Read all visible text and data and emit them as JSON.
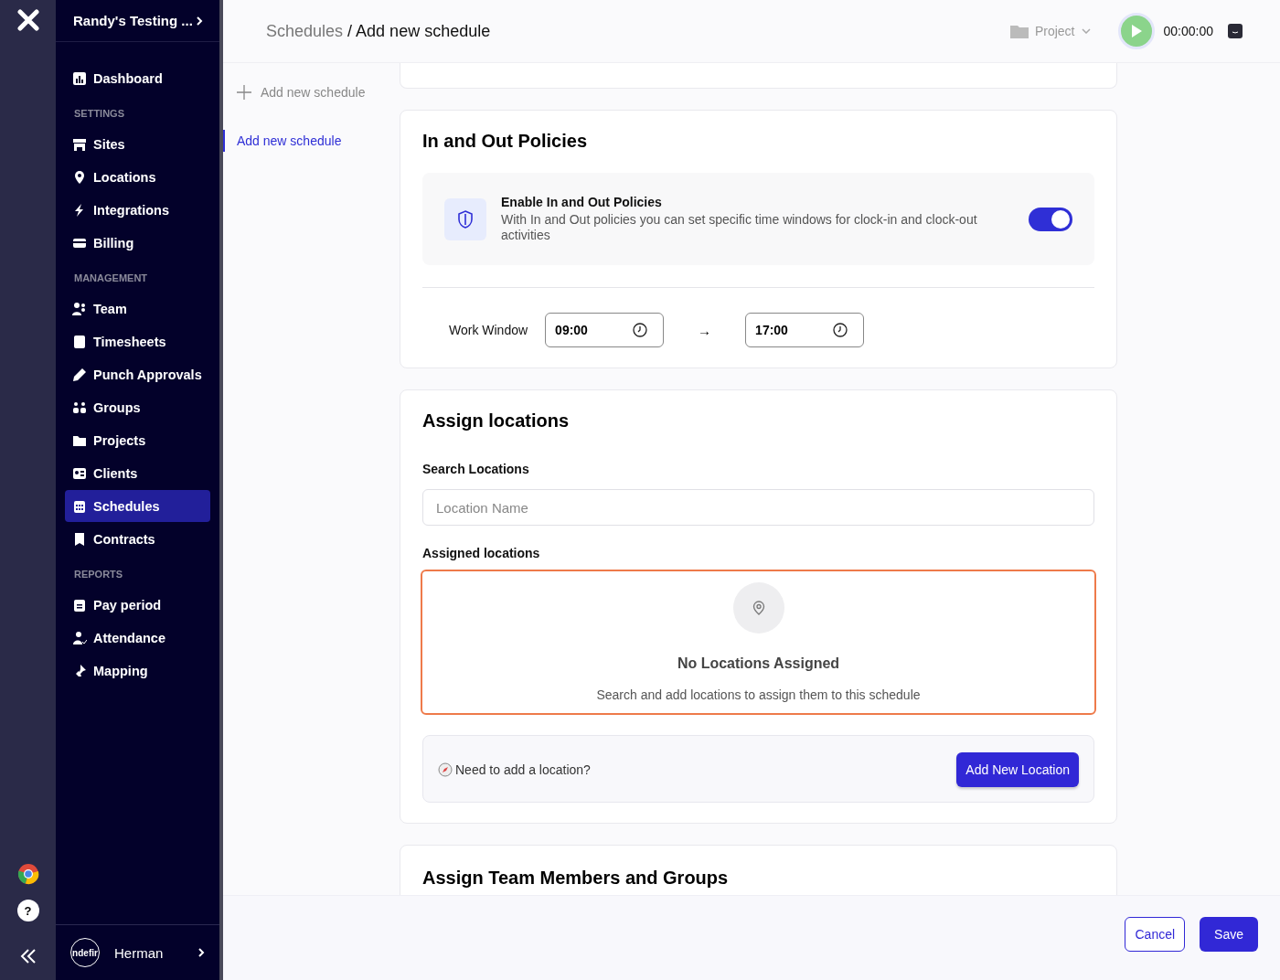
{
  "workspace": {
    "name": "Randy's Testing ..."
  },
  "sidebar": {
    "sections": [
      {
        "items": [
          {
            "label": "Dashboard",
            "selected": false
          }
        ]
      },
      {
        "heading": "SETTINGS",
        "items": [
          {
            "label": "Sites",
            "selected": false
          },
          {
            "label": "Locations",
            "selected": false
          },
          {
            "label": "Integrations",
            "selected": false
          },
          {
            "label": "Billing",
            "selected": false
          }
        ]
      },
      {
        "heading": "MANAGEMENT",
        "items": [
          {
            "label": "Team",
            "selected": false
          },
          {
            "label": "Timesheets",
            "selected": false
          },
          {
            "label": "Punch Approvals",
            "selected": false
          },
          {
            "label": "Groups",
            "selected": false
          },
          {
            "label": "Projects",
            "selected": false
          },
          {
            "label": "Clients",
            "selected": false
          },
          {
            "label": "Schedules",
            "selected": true
          },
          {
            "label": "Contracts",
            "selected": false
          }
        ]
      },
      {
        "heading": "REPORTS",
        "items": [
          {
            "label": "Pay period",
            "selected": false
          },
          {
            "label": "Attendance",
            "selected": false
          },
          {
            "label": "Mapping",
            "selected": false
          }
        ]
      }
    ]
  },
  "help": {
    "label": "?"
  },
  "user": {
    "avatar_text": "ndefir",
    "name": "Herman"
  },
  "header": {
    "breadcrumb": [
      {
        "label": "Schedules"
      },
      {
        "label": "/ Add new schedule"
      }
    ],
    "project": "Project",
    "timer": "00:00:00"
  },
  "subnav": {
    "add": "Add new schedule",
    "items": [
      {
        "label": "Add new schedule",
        "selected": true
      }
    ]
  },
  "policies": {
    "title": "In and Out Policies",
    "enable_title": "Enable In and Out Policies",
    "enable_text": "With In and Out policies you can set specific time windows for clock-in and clock-out activities",
    "on": true,
    "work_window_label": "Work Window",
    "start": "09:00",
    "arrow": "→",
    "end": "17:00"
  },
  "locations": {
    "title": "Assign locations",
    "search_label": "Search Locations",
    "search_placeholder": "Location Name",
    "assigned_label": "Assigned locations",
    "empty_title": "No Locations Assigned",
    "empty_text": "Search and add locations to assign them to this schedule",
    "need_text": "Need to add a location?",
    "add_button": "Add New Location"
  },
  "team": {
    "title": "Assign Team Members and Groups"
  },
  "footer": {
    "cancel": "Cancel",
    "save": "Save"
  }
}
